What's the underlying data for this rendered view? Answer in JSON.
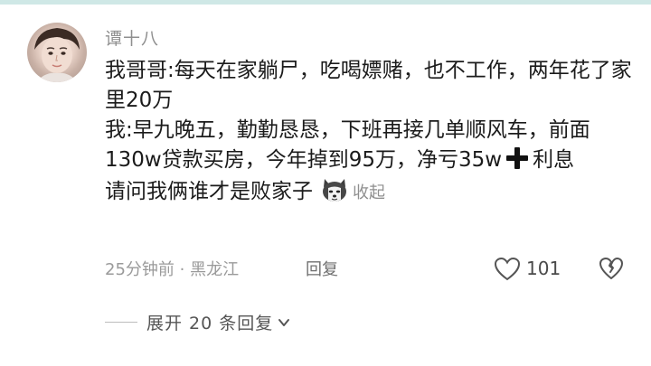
{
  "comment": {
    "username": "谭十八",
    "lines": [
      "我哥哥:每天在家躺尸，吃喝嫖赌，也不工作，两年花了家里20万",
      "我:早九晚五，勤勤恳恳，下班再接几单顺风车，前面130w贷款买房，今年掉到95万，净亏35w",
      "利息",
      "请问我俩谁才是败家子"
    ],
    "collapse_label": "收起",
    "time_location": "25分钟前 · 黑龙江",
    "reply_label": "回复",
    "like_count": "101"
  },
  "replies": {
    "expand_label": "展开 20 条回复"
  },
  "icons": {
    "avatar": "user-avatar",
    "plus": "plus-icon",
    "emoji": "husky-dog-emoji-icon",
    "like": "heart-icon",
    "dislike": "broken-heart-icon",
    "chevron": "chevron-down-icon"
  },
  "colors": {
    "text": "#1b1b1b",
    "secondary": "#8f8f8f",
    "top_bar": "#cfe8e6"
  }
}
